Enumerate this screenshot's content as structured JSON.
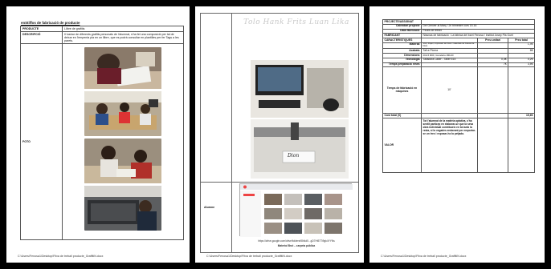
{
  "page1": {
    "title": "enStiffos de fabricació de producte",
    "rows": [
      {
        "label": "PRODUCTE",
        "value": "Llibre de grafitis"
      },
      {
        "label": "DESCRIPCIÓ",
        "value": "Il·lustrar de diferents grafitis personals de l'alumnat, s'ha fet una composició per tal de deixar en l'empenta pla en un llibre, que es podrà consultar en plantilles per fer Tags a les parets."
      },
      {
        "label": "FOTO",
        "value": ""
      }
    ],
    "footer": "C:\\Users\\Fenosa1\\Desktop\\Fitxa de treball producte_GraffitiN.docx"
  },
  "page2": {
    "graffiti_text": "Tolo Hank Frits Luan Lika",
    "label_alumne": "Alumne",
    "url": "https://drive.google.com/drive/folders/f8h4d5...gD7Ht57Ti9gk4YYNs",
    "caption": "Material Brut – carpeta pública",
    "machine_text": "Dion",
    "footer": "C:\\Users\\Fenosa1\\Desktop\\Fitxa de treball producte_GraffitiN.docx"
  },
  "page3": {
    "rows": [
      {
        "label": "PROJECTE/ASSIGNAT",
        "value": "",
        "c2": "",
        "c3": ""
      },
      {
        "label": "Calendari projecte",
        "value": "Del Genver al Març / 2n trimestre curs 15-16",
        "c2": "",
        "c3": ""
      },
      {
        "label": "Data fabricació",
        "value": "Finals de febrer",
        "c2": "",
        "c3": ""
      },
      {
        "label": "FABRICANT",
        "value": "Nissnas de fabricació : La fàbrica del barri Fenosa / Institut Josep Pla Gurri",
        "c2": "",
        "c3": ""
      },
      {
        "label": "CARACTERÍSTIQUES",
        "value": "",
        "c2": "Preu unitari",
        "c3": "Preu total"
      },
      {
        "label": "Material",
        "value": "Vinil, Paper, impressió de fotos i materials de Gravat de fotos",
        "c2": "",
        "c3": "1,4€"
      },
      {
        "label": "Acabats",
        "value": "Tall a Ploma",
        "c2": "",
        "c3": "8€"
      },
      {
        "label": "Dimensions",
        "value": "20x15 MDF, Grandaria 180x20",
        "c2": "",
        "c3": ""
      },
      {
        "label": "Tecnologia",
        "value": "Talladora Laser - Taller 615",
        "c2": "0,4€",
        "c3": "0,2€"
      },
      {
        "label": "Temps preparació eines",
        "value": "",
        "c2": "7€",
        "c3": "3,5€"
      },
      {
        "label": "Temps de fabricació en màquines",
        "value": "10'",
        "c2": "",
        "c3": ""
      },
      {
        "label": "Cost total (€)",
        "value": "",
        "c2": "",
        "c3": "15,6€"
      },
      {
        "label": "VALOR",
        "value": "Tot l'alumnat de la matèria optativa, s'ha sentit partícep en elaborar-se que la seva obra individual contribueix en tot amb la resta, si la vegades endavant per emportar-se un tres i exposar-ho la petjada.",
        "c2": "",
        "c3": ""
      }
    ],
    "footer": "C:\\Users\\Fenosa1\\Desktop\\Fitxa de treball producte_GraffitiN.docx"
  },
  "colors": {
    "background": "#000000",
    "page": "#ffffff"
  }
}
